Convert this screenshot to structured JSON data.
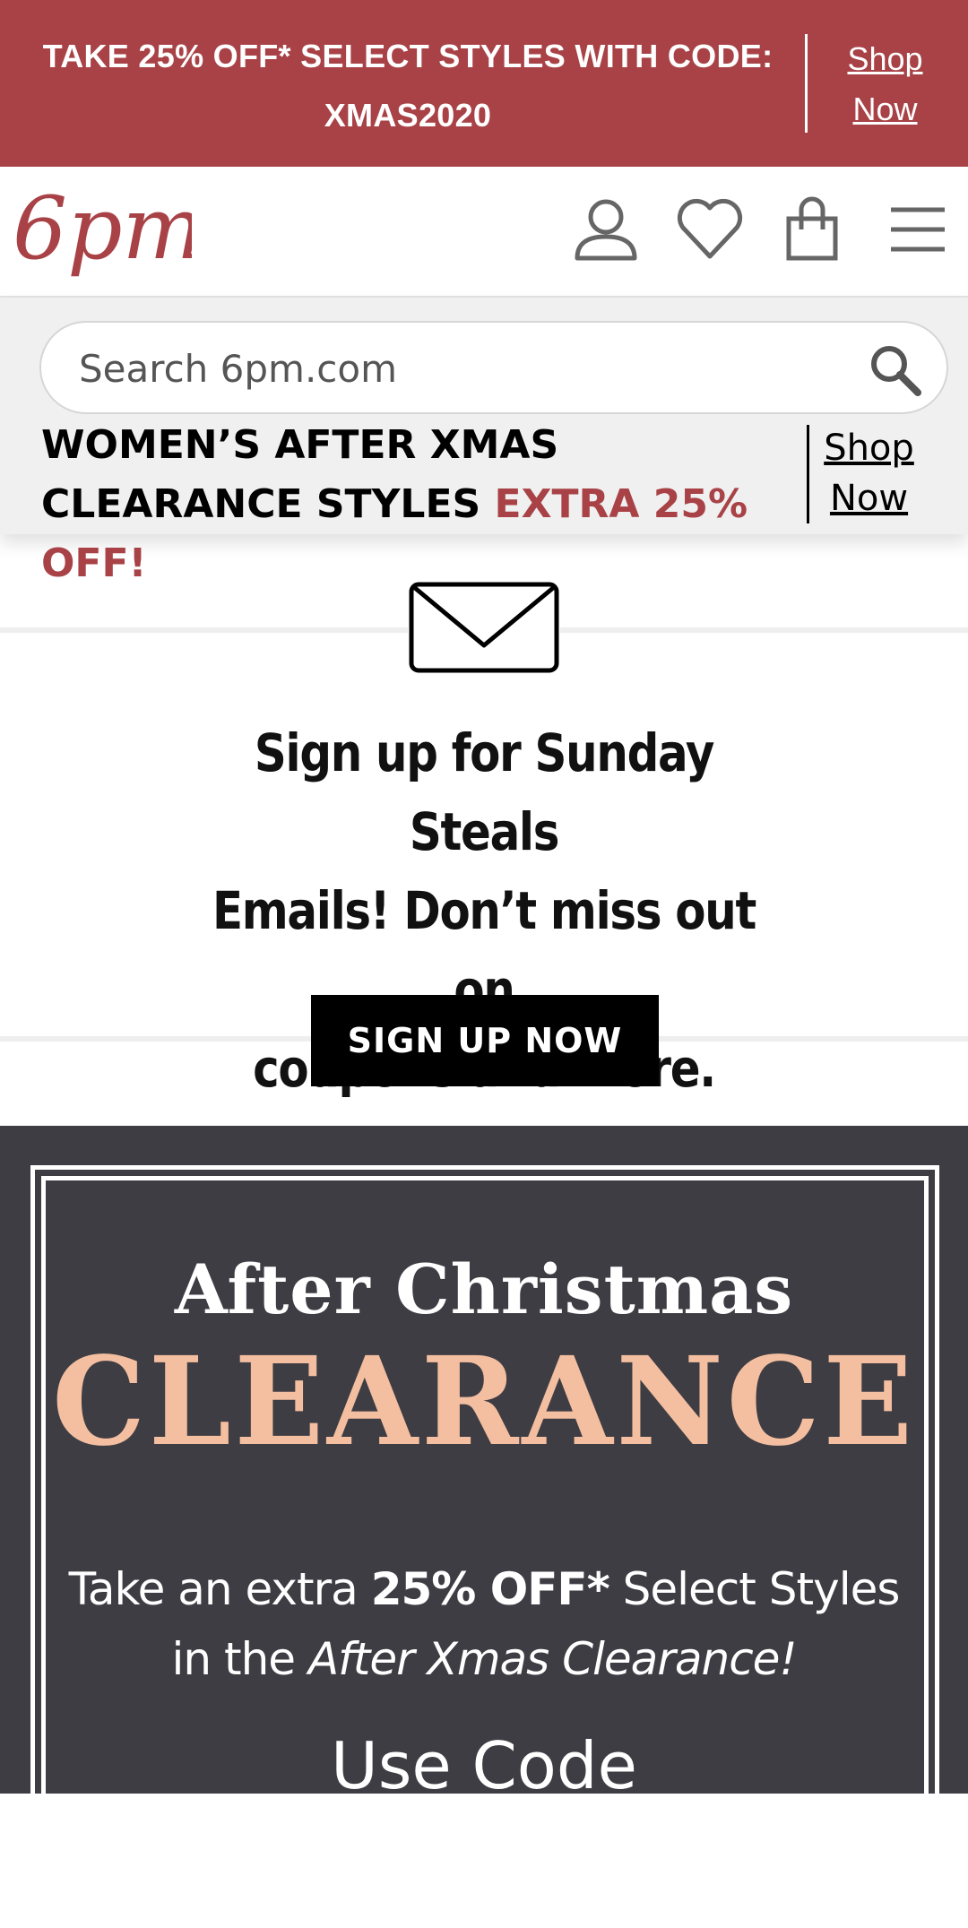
{
  "promo_banner": {
    "line1": "TAKE 25% OFF* SELECT STYLES WITH CODE:",
    "line2": "XMAS2020",
    "link_line1": "Shop",
    "link_line2": "Now"
  },
  "header": {
    "logo_text": "6pm",
    "icons": [
      "user-account-icon",
      "heart-wishlist-icon",
      "shopping-bag-icon",
      "hamburger-menu-icon"
    ]
  },
  "search": {
    "placeholder": "Search 6pm.com",
    "value": ""
  },
  "clearance_banner": {
    "text": "WOMEN’S AFTER XMAS CLEARANCE STYLES",
    "accent": "EXTRA 25% OFF!",
    "link_line1": "Shop",
    "link_line2": "Now"
  },
  "signup": {
    "icon": "envelope-icon",
    "heading_line1": "Sign up for Sunday Steals",
    "heading_line2": "Emails! Don’t miss out on",
    "heading_line3": "coupons and more.",
    "button_label": "SIGN UP NOW"
  },
  "hero": {
    "title": "After Christmas",
    "headline": "CLEARANCE",
    "sub_prefix": "Take an extra ",
    "sub_bold": "25% OFF*",
    "sub_suffix": " Select Styles",
    "sub_line2_prefix": "in the ",
    "sub_line2_italic": "After Xmas Clearance!",
    "partial_text": "Use Code"
  },
  "colors": {
    "brand": "#a84246",
    "hero_bg": "#3e3d44",
    "hero_accent": "#f4bfa0",
    "panel_bg": "#f0f0f0"
  }
}
